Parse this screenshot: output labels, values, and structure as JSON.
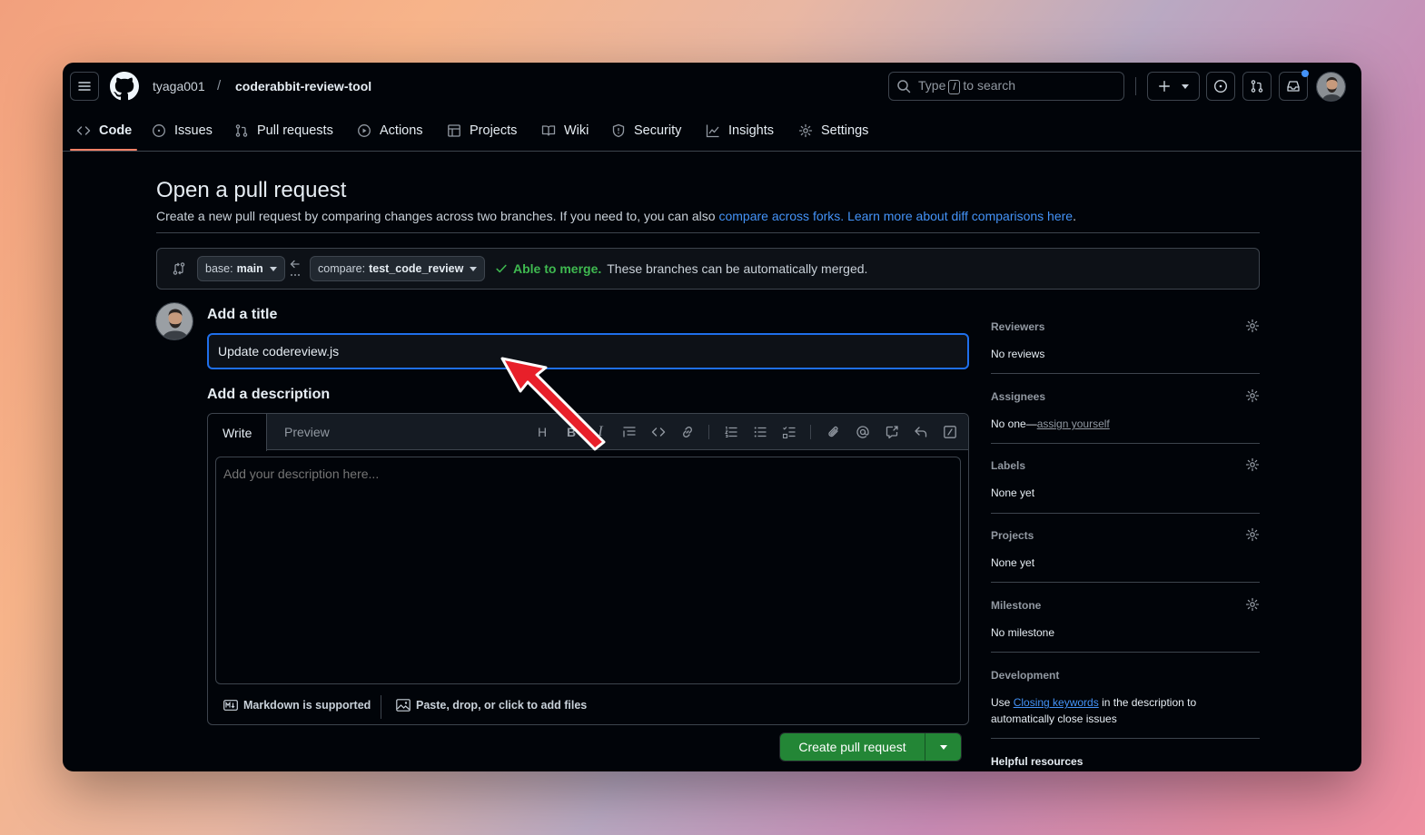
{
  "header": {
    "owner": "tyaga001",
    "slash": "/",
    "repo": "coderabbit-review-tool",
    "search_prefix": "Type",
    "search_key": "/",
    "search_suffix": "to search"
  },
  "tabs": [
    {
      "label": "Code",
      "icon": "code-icon"
    },
    {
      "label": "Issues",
      "icon": "issue-opened-icon"
    },
    {
      "label": "Pull requests",
      "icon": "git-pull-request-icon"
    },
    {
      "label": "Actions",
      "icon": "play-icon"
    },
    {
      "label": "Projects",
      "icon": "table-icon"
    },
    {
      "label": "Wiki",
      "icon": "book-icon"
    },
    {
      "label": "Security",
      "icon": "shield-icon"
    },
    {
      "label": "Insights",
      "icon": "graph-icon"
    },
    {
      "label": "Settings",
      "icon": "gear-icon"
    }
  ],
  "page": {
    "title": "Open a pull request",
    "subtitle_text": "Create a new pull request by comparing changes across two branches. If you need to, you can also ",
    "link_forks": "compare across forks.",
    "link_learn": "Learn more about diff comparisons here",
    "subtitle_end": "."
  },
  "compare": {
    "base_prefix": "base:",
    "base_value": "main",
    "compare_prefix": "compare:",
    "compare_value": "test_code_review",
    "merge_ok": "Able to merge.",
    "merge_text": "These branches can be automatically merged."
  },
  "form": {
    "title_label": "Add a title",
    "title_value": "Update codereview.js",
    "description_label": "Add a description",
    "tab_write": "Write",
    "tab_preview": "Preview",
    "description_placeholder": "Add your description here...",
    "markdown_note": "Markdown is supported",
    "files_note": "Paste, drop, or click to add files",
    "create_button": "Create pull request"
  },
  "sidebar": {
    "reviewers": {
      "title": "Reviewers",
      "value": "No reviews"
    },
    "assignees": {
      "title": "Assignees",
      "value_prefix": "No one—",
      "link": "assign yourself"
    },
    "labels": {
      "title": "Labels",
      "value": "None yet"
    },
    "projects": {
      "title": "Projects",
      "value": "None yet"
    },
    "milestone": {
      "title": "Milestone",
      "value": "No milestone"
    },
    "development": {
      "title": "Development",
      "prefix": "Use ",
      "link": "Closing keywords",
      "suffix": " in the description to automatically close issues"
    },
    "helpful": {
      "title": "Helpful resources"
    }
  },
  "colors": {
    "accent": "#4493f8",
    "success": "#3fb950",
    "primary_button": "#238636",
    "annotation_arrow": "#e8202a"
  }
}
